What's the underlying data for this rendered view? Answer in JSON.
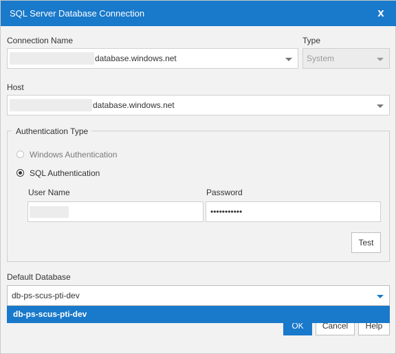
{
  "window": {
    "title": "SQL Server Database Connection",
    "close_label": "x"
  },
  "connection_name": {
    "label": "Connection Name",
    "value_suffix": "database.windows.net"
  },
  "type": {
    "label": "Type",
    "value": "System"
  },
  "host": {
    "label": "Host",
    "value_suffix": "database.windows.net"
  },
  "auth": {
    "legend": "Authentication Type",
    "options": [
      {
        "label": "Windows Authentication",
        "checked": false
      },
      {
        "label": "SQL Authentication",
        "checked": true
      }
    ],
    "username_label": "User Name",
    "password_label": "Password",
    "password_value": "•••••••••••",
    "test_label": "Test"
  },
  "default_database": {
    "label": "Default Database",
    "value": "db-ps-scus-pti-dev",
    "open_option": "db-ps-scus-pti-dev"
  },
  "buttons": {
    "ok": "OK",
    "cancel": "Cancel",
    "help": "Help"
  },
  "colors": {
    "accent": "#1979ca",
    "background": "#f2f2f2",
    "border": "#cfcfcf"
  }
}
